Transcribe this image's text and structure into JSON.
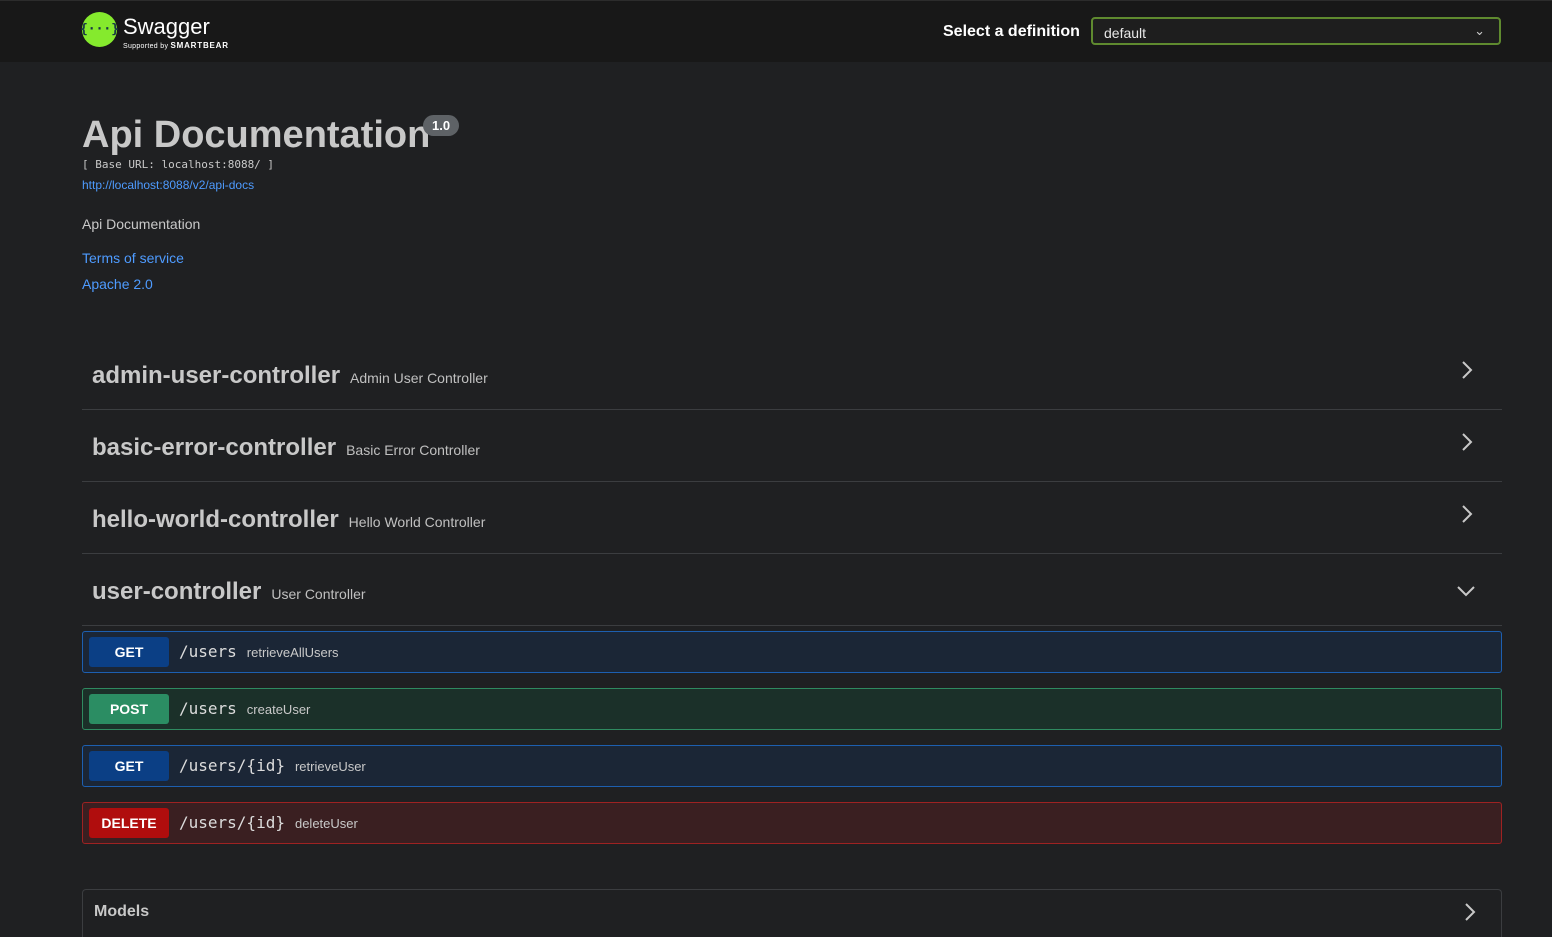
{
  "header": {
    "logo_glyph": "{···}",
    "logo_title": "Swagger",
    "logo_sub_prefix": "Supported by",
    "logo_sub_brand": "SMARTBEAR",
    "definition_label": "Select a definition",
    "definition_value": "default"
  },
  "info": {
    "title": "Api Documentation",
    "version": "1.0",
    "base_url": "[ Base URL: localhost:8088/ ]",
    "docs_url": "http://localhost:8088/v2/api-docs",
    "description": "Api Documentation",
    "terms": "Terms of service",
    "license": "Apache 2.0"
  },
  "tags": [
    {
      "name": "admin-user-controller",
      "description": "Admin User Controller",
      "expanded": false
    },
    {
      "name": "basic-error-controller",
      "description": "Basic Error Controller",
      "expanded": false
    },
    {
      "name": "hello-world-controller",
      "description": "Hello World Controller",
      "expanded": false
    },
    {
      "name": "user-controller",
      "description": "User Controller",
      "expanded": true
    }
  ],
  "operations": [
    {
      "method": "GET",
      "path": "/users",
      "summary": "retrieveAllUsers"
    },
    {
      "method": "POST",
      "path": "/users",
      "summary": "createUser"
    },
    {
      "method": "GET",
      "path": "/users/{id}",
      "summary": "retrieveUser"
    },
    {
      "method": "DELETE",
      "path": "/users/{id}",
      "summary": "deleteUser"
    }
  ],
  "models": {
    "title": "Models"
  },
  "colors": {
    "background": "#1f2022",
    "topbar": "#181818",
    "logo_green": "#85ea2d",
    "link": "#4e9bff",
    "get": "#0b3f85",
    "post": "#2b8d63",
    "delete": "#b00d0d"
  }
}
